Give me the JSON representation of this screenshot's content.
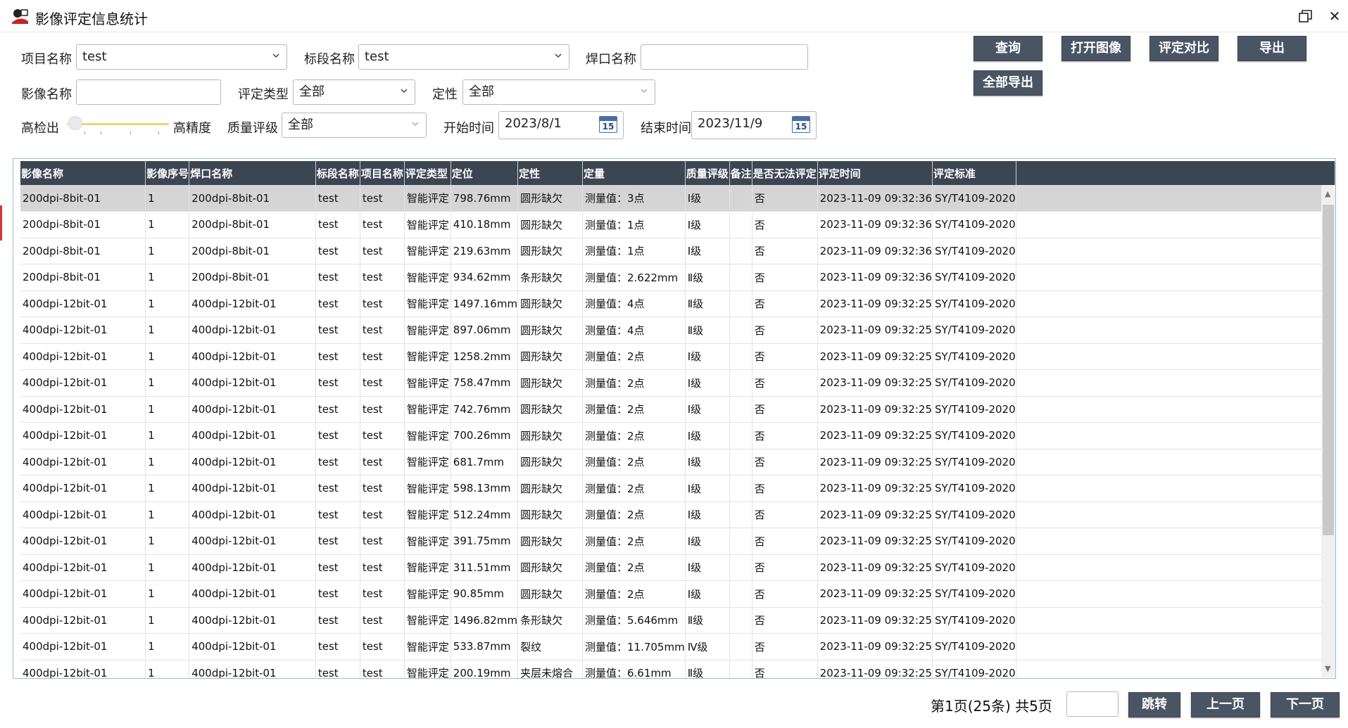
{
  "window": {
    "title": "影像评定信息统计"
  },
  "filters": {
    "project_label": "项目名称",
    "project_value": "test",
    "segment_label": "标段名称",
    "segment_value": "test",
    "weld_label": "焊口名称",
    "weld_value": "",
    "image_label": "影像名称",
    "image_value": "",
    "eval_type_label": "评定类型",
    "eval_type_value": "全部",
    "qual_label": "定性",
    "qual_value": "全部",
    "slider_left_label": "高检出",
    "slider_right_label": "高精度",
    "quality_label": "质量评级",
    "quality_value": "全部",
    "start_label": "开始时间",
    "start_value": "2023/8/1",
    "end_label": "结束时间",
    "end_value": "2023/11/9",
    "calendar_day": "15"
  },
  "toolbar": {
    "query": "查询",
    "open_image": "打开图像",
    "compare": "评定对比",
    "export": "导出",
    "export_all": "全部导出"
  },
  "table": {
    "columns": [
      "影像名称",
      "影像序号",
      "焊口名称",
      "标段名称",
      "项目名称",
      "评定类型",
      "定位",
      "定性",
      "定量",
      "质量评级",
      "备注",
      "是否无法评定",
      "评定时间",
      "评定标准"
    ],
    "rows": [
      [
        "200dpi-8bit-01",
        "1",
        "200dpi-8bit-01",
        "test",
        "test",
        "智能评定",
        "798.76mm",
        "圆形缺欠",
        "测量值：3点",
        "Ⅰ级",
        "",
        "否",
        "2023-11-09 09:32:36",
        "SY/T4109-2020"
      ],
      [
        "200dpi-8bit-01",
        "1",
        "200dpi-8bit-01",
        "test",
        "test",
        "智能评定",
        "410.18mm",
        "圆形缺欠",
        "测量值：1点",
        "Ⅰ级",
        "",
        "否",
        "2023-11-09 09:32:36",
        "SY/T4109-2020"
      ],
      [
        "200dpi-8bit-01",
        "1",
        "200dpi-8bit-01",
        "test",
        "test",
        "智能评定",
        "219.63mm",
        "圆形缺欠",
        "测量值：1点",
        "Ⅰ级",
        "",
        "否",
        "2023-11-09 09:32:36",
        "SY/T4109-2020"
      ],
      [
        "200dpi-8bit-01",
        "1",
        "200dpi-8bit-01",
        "test",
        "test",
        "智能评定",
        "934.62mm",
        "条形缺欠",
        "测量值：2.622mm",
        "Ⅱ级",
        "",
        "否",
        "2023-11-09 09:32:36",
        "SY/T4109-2020"
      ],
      [
        "400dpi-12bit-01",
        "1",
        "400dpi-12bit-01",
        "test",
        "test",
        "智能评定",
        "1497.16mm",
        "圆形缺欠",
        "测量值：4点",
        "Ⅱ级",
        "",
        "否",
        "2023-11-09 09:32:25",
        "SY/T4109-2020"
      ],
      [
        "400dpi-12bit-01",
        "1",
        "400dpi-12bit-01",
        "test",
        "test",
        "智能评定",
        "897.06mm",
        "圆形缺欠",
        "测量值：4点",
        "Ⅱ级",
        "",
        "否",
        "2023-11-09 09:32:25",
        "SY/T4109-2020"
      ],
      [
        "400dpi-12bit-01",
        "1",
        "400dpi-12bit-01",
        "test",
        "test",
        "智能评定",
        "1258.2mm",
        "圆形缺欠",
        "测量值：2点",
        "Ⅰ级",
        "",
        "否",
        "2023-11-09 09:32:25",
        "SY/T4109-2020"
      ],
      [
        "400dpi-12bit-01",
        "1",
        "400dpi-12bit-01",
        "test",
        "test",
        "智能评定",
        "758.47mm",
        "圆形缺欠",
        "测量值：2点",
        "Ⅰ级",
        "",
        "否",
        "2023-11-09 09:32:25",
        "SY/T4109-2020"
      ],
      [
        "400dpi-12bit-01",
        "1",
        "400dpi-12bit-01",
        "test",
        "test",
        "智能评定",
        "742.76mm",
        "圆形缺欠",
        "测量值：2点",
        "Ⅰ级",
        "",
        "否",
        "2023-11-09 09:32:25",
        "SY/T4109-2020"
      ],
      [
        "400dpi-12bit-01",
        "1",
        "400dpi-12bit-01",
        "test",
        "test",
        "智能评定",
        "700.26mm",
        "圆形缺欠",
        "测量值：2点",
        "Ⅰ级",
        "",
        "否",
        "2023-11-09 09:32:25",
        "SY/T4109-2020"
      ],
      [
        "400dpi-12bit-01",
        "1",
        "400dpi-12bit-01",
        "test",
        "test",
        "智能评定",
        "681.7mm",
        "圆形缺欠",
        "测量值：2点",
        "Ⅰ级",
        "",
        "否",
        "2023-11-09 09:32:25",
        "SY/T4109-2020"
      ],
      [
        "400dpi-12bit-01",
        "1",
        "400dpi-12bit-01",
        "test",
        "test",
        "智能评定",
        "598.13mm",
        "圆形缺欠",
        "测量值：2点",
        "Ⅰ级",
        "",
        "否",
        "2023-11-09 09:32:25",
        "SY/T4109-2020"
      ],
      [
        "400dpi-12bit-01",
        "1",
        "400dpi-12bit-01",
        "test",
        "test",
        "智能评定",
        "512.24mm",
        "圆形缺欠",
        "测量值：2点",
        "Ⅰ级",
        "",
        "否",
        "2023-11-09 09:32:25",
        "SY/T4109-2020"
      ],
      [
        "400dpi-12bit-01",
        "1",
        "400dpi-12bit-01",
        "test",
        "test",
        "智能评定",
        "391.75mm",
        "圆形缺欠",
        "测量值：2点",
        "Ⅰ级",
        "",
        "否",
        "2023-11-09 09:32:25",
        "SY/T4109-2020"
      ],
      [
        "400dpi-12bit-01",
        "1",
        "400dpi-12bit-01",
        "test",
        "test",
        "智能评定",
        "311.51mm",
        "圆形缺欠",
        "测量值：2点",
        "Ⅰ级",
        "",
        "否",
        "2023-11-09 09:32:25",
        "SY/T4109-2020"
      ],
      [
        "400dpi-12bit-01",
        "1",
        "400dpi-12bit-01",
        "test",
        "test",
        "智能评定",
        "90.85mm",
        "圆形缺欠",
        "测量值：2点",
        "Ⅰ级",
        "",
        "否",
        "2023-11-09 09:32:25",
        "SY/T4109-2020"
      ],
      [
        "400dpi-12bit-01",
        "1",
        "400dpi-12bit-01",
        "test",
        "test",
        "智能评定",
        "1496.82mm",
        "条形缺欠",
        "测量值：5.646mm",
        "Ⅱ级",
        "",
        "否",
        "2023-11-09 09:32:25",
        "SY/T4109-2020"
      ],
      [
        "400dpi-12bit-01",
        "1",
        "400dpi-12bit-01",
        "test",
        "test",
        "智能评定",
        "533.87mm",
        "裂纹",
        "测量值：11.705mm",
        "Ⅳ级",
        "",
        "否",
        "2023-11-09 09:32:25",
        "SY/T4109-2020"
      ],
      [
        "400dpi-12bit-01",
        "1",
        "400dpi-12bit-01",
        "test",
        "test",
        "智能评定",
        "200.19mm",
        "夹层未熔合",
        "测量值：6.61mm",
        "Ⅱ级",
        "",
        "否",
        "2023-11-09 09:32:25",
        "SY/T4109-2020"
      ]
    ],
    "selected_row": 0
  },
  "pager": {
    "info": "第1页(25条) 共5页",
    "jump_value": "",
    "jump": "跳转",
    "prev": "上一页",
    "next": "下一页"
  },
  "colors": {
    "header_bg": "#3c4653",
    "button_bg": "#4a5564",
    "grade_blue": "#1a6fd0",
    "grade_red": "#e02020"
  }
}
